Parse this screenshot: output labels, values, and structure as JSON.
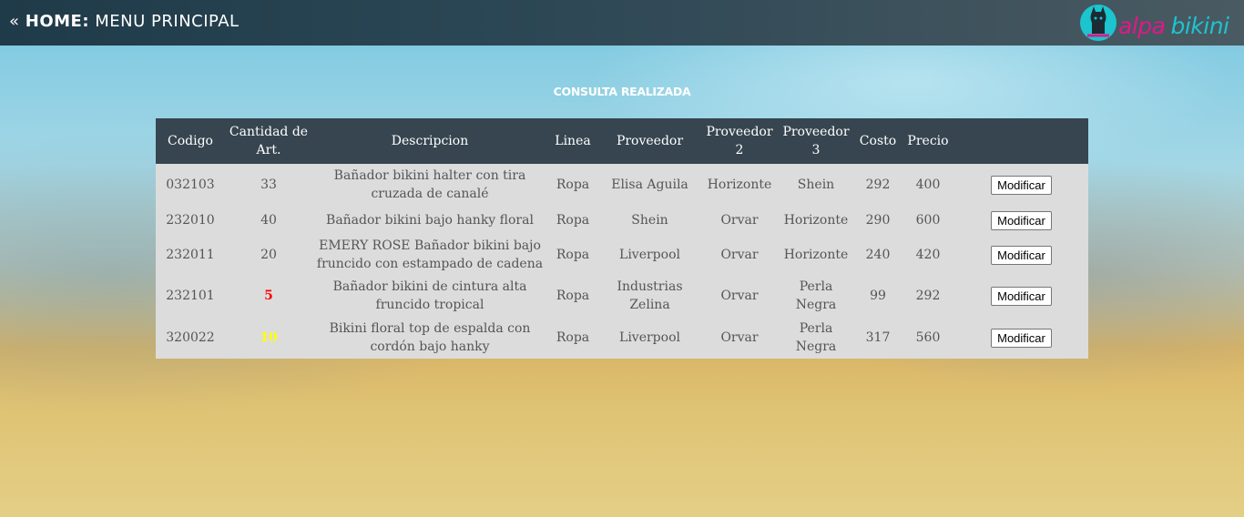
{
  "header": {
    "back_glyph": "«",
    "home_label": "HOME:",
    "section_label": "MENU PRINCIPAL",
    "logo": {
      "word1": "alpa",
      "word2": "bikini",
      "colors": {
        "pink": "#e0188a",
        "teal": "#1cc4cf"
      }
    }
  },
  "page": {
    "title": "CONSULTA REALIZADA"
  },
  "table": {
    "headers": [
      "Codigo",
      "Cantidad de Art.",
      "Descripcion",
      "Linea",
      "Proveedor",
      "Proveedor 2",
      "Proveedor 3",
      "Costo",
      "Precio"
    ],
    "action_label": "Modificar",
    "rows": [
      {
        "codigo": "032103",
        "cantidad": "33",
        "descripcion": "Bañador bikini halter con tira cruzada de canalé",
        "linea": "Ropa",
        "proveedor": "Elisa Aguila",
        "proveedor2": "Horizonte",
        "proveedor3": "Shein",
        "costo": "292",
        "precio": "400",
        "stock_status": "normal"
      },
      {
        "codigo": "232010",
        "cantidad": "40",
        "descripcion": "Bañador bikini bajo hanky floral",
        "linea": "Ropa",
        "proveedor": "Shein",
        "proveedor2": "Orvar",
        "proveedor3": "Horizonte",
        "costo": "290",
        "precio": "600",
        "stock_status": "normal"
      },
      {
        "codigo": "232011",
        "cantidad": "20",
        "descripcion": "EMERY ROSE Bañador bikini bajo fruncido con estampado de cadena",
        "linea": "Ropa",
        "proveedor": "Liverpool",
        "proveedor2": "Orvar",
        "proveedor3": "Horizonte",
        "costo": "240",
        "precio": "420",
        "stock_status": "normal"
      },
      {
        "codigo": "232101",
        "cantidad": "5",
        "descripcion": "Bañador bikini de cintura alta fruncido tropical",
        "linea": "Ropa",
        "proveedor": "Industrias Zelina",
        "proveedor2": "Orvar",
        "proveedor3": "Perla Negra",
        "costo": "99",
        "precio": "292",
        "stock_status": "low",
        "stock_color": "#ff0000"
      },
      {
        "codigo": "320022",
        "cantidad": "10",
        "descripcion": "Bikini floral top de espalda con cordón bajo hanky",
        "linea": "Ropa",
        "proveedor": "Liverpool",
        "proveedor2": "Orvar",
        "proveedor3": "Perla Negra",
        "costo": "317",
        "precio": "560",
        "stock_status": "medium",
        "stock_color": "#ffff00"
      }
    ]
  }
}
